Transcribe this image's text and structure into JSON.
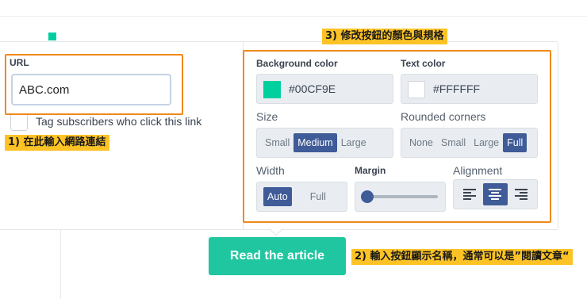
{
  "url_field": {
    "label": "URL",
    "value": "ABC.com"
  },
  "checkbox": {
    "label": "Tag subscribers who click this link",
    "checked": false
  },
  "annotations": {
    "url": "1) 在此輸入網路連結",
    "button": "2) 輸入按鈕顯示名稱，通常可以是”閱讀文章“",
    "style": "3) 修改按鈕的顏色與規格"
  },
  "colors": {
    "background": {
      "label": "Background color",
      "value": "#00CF9E"
    },
    "text": {
      "label": "Text color",
      "value": "#FFFFFF"
    },
    "annotation_border": "#f0891b",
    "annotation_fill": "#fdc326",
    "active_segment": "#3f5b98"
  },
  "size": {
    "label": "Size",
    "options": [
      "Small",
      "Medium",
      "Large"
    ],
    "selected": "Medium"
  },
  "rounded_corners": {
    "label": "Rounded corners",
    "options": [
      "None",
      "Small",
      "Large",
      "Full"
    ],
    "selected": "Full"
  },
  "width": {
    "label": "Width",
    "options": [
      "Auto",
      "Full"
    ],
    "selected": "Auto"
  },
  "margin": {
    "label": "Margin",
    "level": 0
  },
  "alignment": {
    "label": "Alignment",
    "options": [
      "align-left-icon",
      "align-center-icon",
      "align-right-icon"
    ],
    "selected": "align-center-icon"
  },
  "preview_button": {
    "label": "Read the article"
  }
}
